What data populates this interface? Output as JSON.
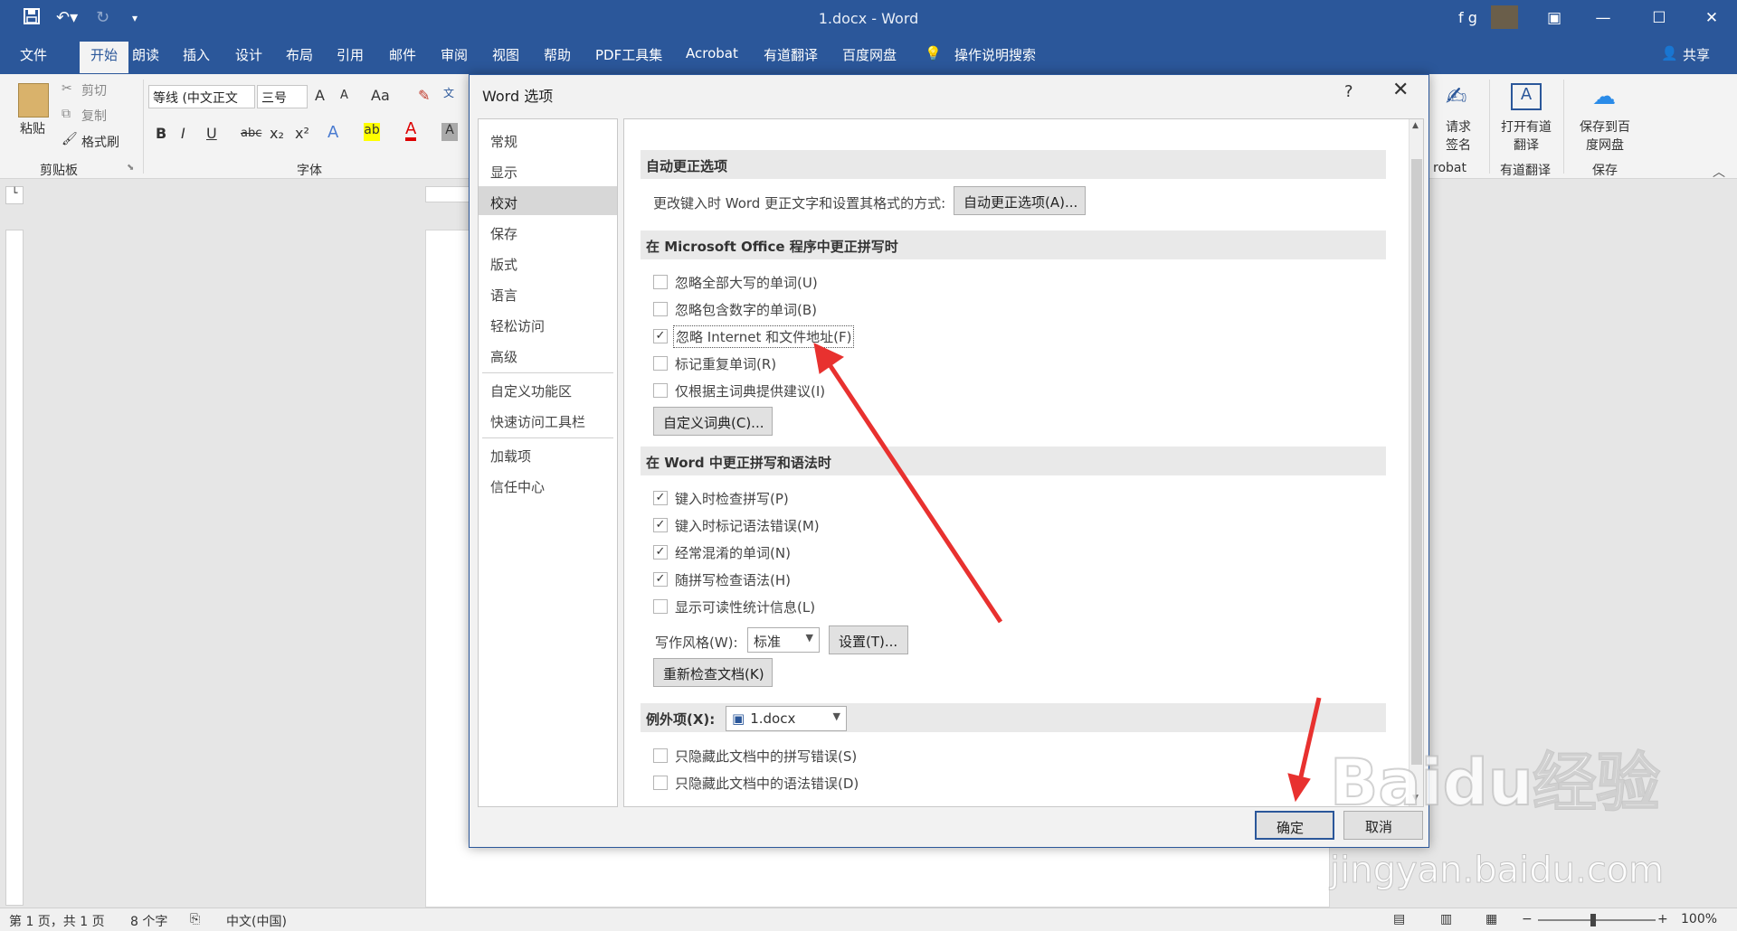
{
  "titlebar": {
    "title": "1.docx - Word",
    "user": "f g",
    "save_icon": "save-icon",
    "undo_icon": "undo-icon",
    "redo_icon": "redo-icon",
    "customize_icon": "customize-qat-icon",
    "minimize": "—",
    "restore": "☐",
    "close": "✕",
    "ribbon_options": "▣"
  },
  "tabs": [
    "文件",
    "开始",
    "朗读",
    "插入",
    "设计",
    "布局",
    "引用",
    "邮件",
    "审阅",
    "视图",
    "帮助",
    "PDF工具集",
    "Acrobat",
    "有道翻译",
    "百度网盘"
  ],
  "tell_me": "操作说明搜索",
  "share": "共享",
  "ribbon": {
    "paste": "粘贴",
    "cut": "剪切",
    "copy": "复制",
    "format_painter": "格式刷",
    "clipboard_group": "剪贴板",
    "font_name": "等线 (中文正文",
    "font_size": "三号",
    "font_group": "字体",
    "bold": "B",
    "italic": "I",
    "underline": "U",
    "strike": "abc",
    "subscript": "x₂",
    "superscript": "x²",
    "grow": "A",
    "shrink": "A",
    "change_case": "Aa",
    "request_sign": "请求签名",
    "acrobat_group": "robat",
    "open_youdao": "打开有道翻译",
    "youdao_group": "有道翻译",
    "save_baidu": "保存到百度网盘",
    "save_group": "保存"
  },
  "statusbar": {
    "page": "第 1 页，共 1 页",
    "words": "8 个字",
    "lang": "中文(中国)",
    "zoom": "100%",
    "zoom_minus": "−",
    "zoom_plus": "+"
  },
  "dialog": {
    "title": "Word 选项",
    "help": "?",
    "close": "✕",
    "nav": [
      "常规",
      "显示",
      "校对",
      "保存",
      "版式",
      "语言",
      "轻松访问",
      "高级",
      "自定义功能区",
      "快速访问工具栏",
      "加载项",
      "信任中心"
    ],
    "selected_nav": "校对",
    "sections": {
      "autocorrect_header": "自动更正选项",
      "autocorrect_text": "更改键入时 Word 更正文字和设置其格式的方式:",
      "autocorrect_button": "自动更正选项(A)...",
      "office_header": "在 Microsoft Office 程序中更正拼写时",
      "office_checks": [
        {
          "label": "忽略全部大写的单词(U)",
          "checked": false
        },
        {
          "label": "忽略包含数字的单词(B)",
          "checked": false
        },
        {
          "label": "忽略 Internet 和文件地址(F)",
          "checked": true
        },
        {
          "label": "标记重复单词(R)",
          "checked": false
        },
        {
          "label": "仅根据主词典提供建议(I)",
          "checked": false
        }
      ],
      "custom_dict_button": "自定义词典(C)...",
      "word_header": "在 Word 中更正拼写和语法时",
      "word_checks": [
        {
          "label": "键入时检查拼写(P)",
          "checked": true
        },
        {
          "label": "键入时标记语法错误(M)",
          "checked": true
        },
        {
          "label": "经常混淆的单词(N)",
          "checked": true
        },
        {
          "label": "随拼写检查语法(H)",
          "checked": true
        },
        {
          "label": "显示可读性统计信息(L)",
          "checked": false
        }
      ],
      "writing_style_label": "写作风格(W):",
      "writing_style_value": "标准",
      "settings_button": "设置(T)...",
      "recheck_button": "重新检查文档(K)",
      "exceptions_label": "例外项(X):",
      "exceptions_value": "1.docx",
      "exception_checks": [
        {
          "label": "只隐藏此文档中的拼写错误(S)",
          "checked": false
        },
        {
          "label": "只隐藏此文档中的语法错误(D)",
          "checked": false
        }
      ]
    },
    "ok": "确定",
    "cancel": "取消"
  },
  "watermark": {
    "main": "Baidu经验",
    "sub": "jingyan.baidu.com"
  },
  "colors": {
    "brand": "#2b579a",
    "arrow": "#e8312f"
  }
}
